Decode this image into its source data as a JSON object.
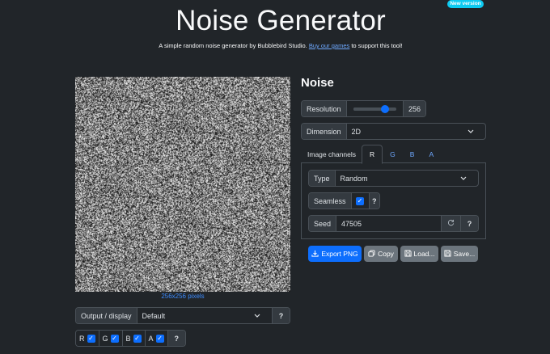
{
  "header": {
    "badge": "New version",
    "title": "Noise Generator",
    "subtitle_before": "A simple random noise generator by Bubblebird Studio. ",
    "subtitle_link": "Buy our games",
    "subtitle_after": " to support this tool!"
  },
  "preview": {
    "dimensions_label": "256x256 pixels"
  },
  "output": {
    "label": "Output / display",
    "value": "Default",
    "help": "?",
    "channels": [
      {
        "label": "R",
        "checked": true
      },
      {
        "label": "G",
        "checked": true
      },
      {
        "label": "B",
        "checked": true
      },
      {
        "label": "A",
        "checked": true
      }
    ]
  },
  "panel": {
    "title": "Noise",
    "resolution": {
      "label": "Resolution",
      "value": "256",
      "slider_fraction": 0.73
    },
    "dimension": {
      "label": "Dimension",
      "value": "2D"
    },
    "tabs": {
      "label": "Image channels",
      "items": [
        "R",
        "G",
        "B",
        "A"
      ],
      "active": "R"
    },
    "type": {
      "label": "Type",
      "value": "Random"
    },
    "seamless": {
      "label": "Seamless",
      "checked": true,
      "help": "?"
    },
    "seed": {
      "label": "Seed",
      "value": "47505",
      "help": "?"
    }
  },
  "actions": {
    "export": "Export PNG",
    "copy": "Copy",
    "load": "Load...",
    "save": "Save..."
  },
  "colors": {
    "background": "#212529",
    "primary": "#0d6efd",
    "secondary": "#6c757d",
    "link": "#6ea8fe",
    "badge": "#0dcaf0"
  }
}
